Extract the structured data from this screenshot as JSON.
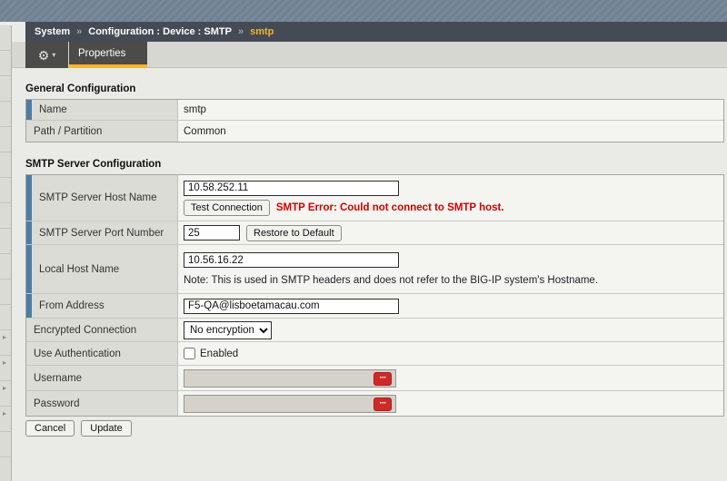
{
  "breadcrumb": {
    "section": "System",
    "separator": "»",
    "path": "Configuration : Device : SMTP",
    "current": "smtp"
  },
  "tabs": {
    "properties_label": "Properties",
    "gear_icon": "⚙",
    "gear_caret": "▾"
  },
  "nav_sliver": {
    "arrow_glyph": "▸"
  },
  "general": {
    "heading": "General Configuration",
    "rows": [
      {
        "label": "Name",
        "value": "smtp"
      },
      {
        "label": "Path / Partition",
        "value": "Common"
      }
    ]
  },
  "smtp": {
    "heading": "SMTP Server Configuration",
    "host": {
      "label": "SMTP Server Host Name",
      "value": "10.58.252.11",
      "test_button": "Test Connection",
      "error": "SMTP Error: Could not connect to SMTP host."
    },
    "port": {
      "label": "SMTP Server Port Number",
      "value": "25",
      "restore_button": "Restore to Default"
    },
    "local_host": {
      "label": "Local Host Name",
      "value": "10.56.16.22",
      "note": "Note: This is used in SMTP headers and does not refer to the BIG-IP system's Hostname."
    },
    "from": {
      "label": "From Address",
      "value": "F5-QA@lisboetamacau.com"
    },
    "encryption": {
      "label": "Encrypted Connection",
      "selected": "No encryption"
    },
    "auth": {
      "label": "Use Authentication",
      "checkbox_label": "Enabled",
      "checked": false
    },
    "username": {
      "label": "Username",
      "value": "",
      "picker_glyph": "···"
    },
    "password": {
      "label": "Password",
      "value": "",
      "picker_glyph": "···"
    }
  },
  "actions": {
    "cancel": "Cancel",
    "update": "Update"
  },
  "colors": {
    "required_bar": "#4d7da2",
    "tab_underline": "#fdb71c",
    "breadcrumb_current": "#f7b322",
    "error_text": "#d40000",
    "picker_button": "#cf2a27",
    "breadcrumb_bar": "#454b54",
    "banner": "#75869a"
  }
}
